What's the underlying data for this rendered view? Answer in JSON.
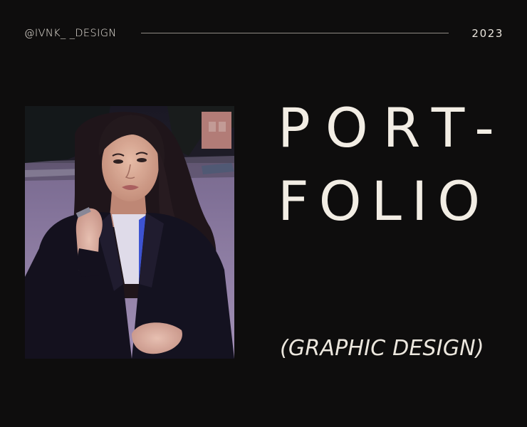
{
  "header": {
    "handle": "@IVNK_ _DESIGN",
    "year": "2023"
  },
  "title": {
    "line1": "PORT-",
    "line2": "FOLIO"
  },
  "subtitle": "(GRAPHIC DESIGN)",
  "colors": {
    "background": "#0e0d0d",
    "text": "#f2ede4",
    "rule": "#8f8a84"
  }
}
